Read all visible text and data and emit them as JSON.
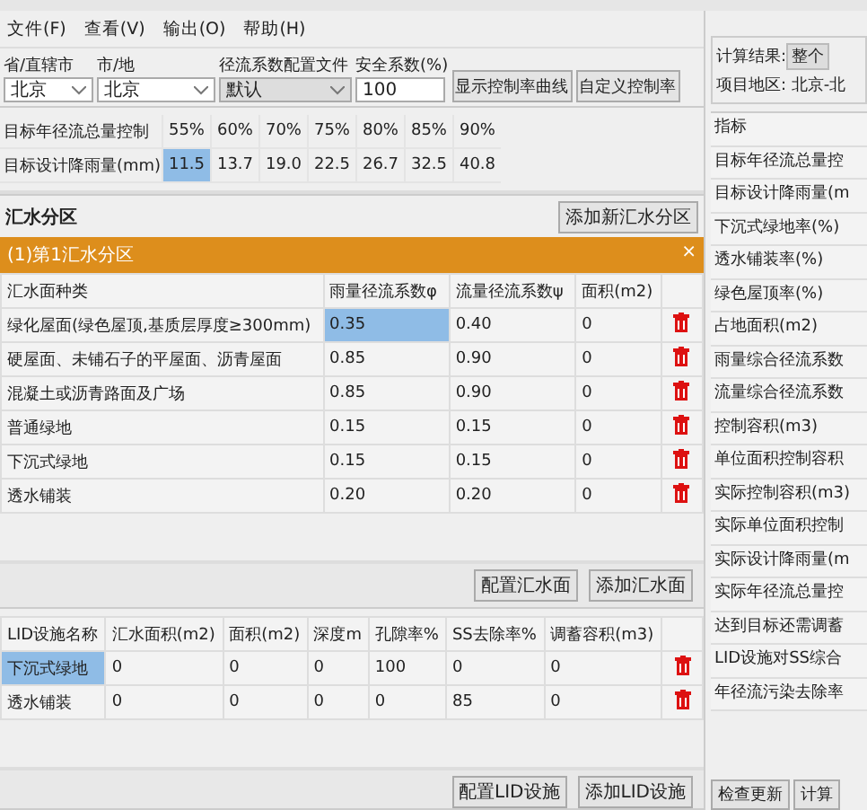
{
  "menu": [
    "文件(F)",
    "查看(V)",
    "输出(O)",
    "帮助(H)"
  ],
  "toolbar": {
    "fields": [
      {
        "label": "省/直辖市",
        "value": "北京",
        "kind": "select"
      },
      {
        "label": "市/地",
        "value": "北京",
        "kind": "select"
      },
      {
        "label": "径流系数配置文件",
        "value": "默认",
        "kind": "select"
      },
      {
        "label": "安全系数(%)",
        "value": "100",
        "kind": "input"
      }
    ],
    "buttons": [
      "显示控制率曲线",
      "自定义控制率"
    ]
  },
  "rates": {
    "row_labels": [
      "目标年径流总量控制",
      "目标设计降雨量(mm)"
    ],
    "columns": [
      {
        "rate": "55%",
        "rainfall": "11.5",
        "selected": true
      },
      {
        "rate": "60%",
        "rainfall": "13.7",
        "selected": false
      },
      {
        "rate": "70%",
        "rainfall": "19.0",
        "selected": false
      },
      {
        "rate": "75%",
        "rainfall": "22.5",
        "selected": false
      },
      {
        "rate": "80%",
        "rainfall": "26.7",
        "selected": false
      },
      {
        "rate": "85%",
        "rainfall": "32.5",
        "selected": false
      },
      {
        "rate": "90%",
        "rainfall": "40.8",
        "selected": false
      }
    ]
  },
  "zones": {
    "title": "汇水分区",
    "add_button": "添加新汇水分区",
    "zone_title": "(1)第1汇水分区",
    "close": "×",
    "columns": [
      "汇水面种类",
      "雨量径流系数φ",
      "流量径流系数ψ",
      "面积(m2)"
    ],
    "rows": [
      {
        "cells": [
          {
            "text": "绿化屋面(绿色屋顶,基质层厚度≥300mm)",
            "selected": false
          },
          {
            "text": "0.35",
            "selected": true
          },
          {
            "text": "0.40",
            "selected": false
          },
          {
            "text": "0",
            "selected": false
          }
        ]
      },
      {
        "cells": [
          {
            "text": "硬屋面、未铺石子的平屋面、沥青屋面",
            "selected": false
          },
          {
            "text": "0.85",
            "selected": false
          },
          {
            "text": "0.90",
            "selected": false
          },
          {
            "text": "0",
            "selected": false
          }
        ]
      },
      {
        "cells": [
          {
            "text": "混凝土或沥青路面及广场",
            "selected": false
          },
          {
            "text": "0.85",
            "selected": false
          },
          {
            "text": "0.90",
            "selected": false
          },
          {
            "text": "0",
            "selected": false
          }
        ]
      },
      {
        "cells": [
          {
            "text": "普通绿地",
            "selected": false
          },
          {
            "text": "0.15",
            "selected": false
          },
          {
            "text": "0.15",
            "selected": false
          },
          {
            "text": "0",
            "selected": false
          }
        ]
      },
      {
        "cells": [
          {
            "text": "下沉式绿地",
            "selected": false
          },
          {
            "text": "0.15",
            "selected": false
          },
          {
            "text": "0.15",
            "selected": false
          },
          {
            "text": "0",
            "selected": false
          }
        ]
      },
      {
        "cells": [
          {
            "text": "透水铺装",
            "selected": false
          },
          {
            "text": "0.20",
            "selected": false
          },
          {
            "text": "0.20",
            "selected": false
          },
          {
            "text": "0",
            "selected": false
          }
        ]
      }
    ],
    "buttons": [
      "配置汇水面",
      "添加汇水面"
    ]
  },
  "lid": {
    "columns": [
      "LID设施名称",
      "汇水面积(m2)",
      "面积(m2)",
      "深度m",
      "孔隙率%",
      "SS去除率%",
      "调蓄容积(m3)"
    ],
    "rows": [
      {
        "cells": [
          {
            "text": "下沉式绿地",
            "selected": true
          },
          {
            "text": "0",
            "selected": false
          },
          {
            "text": "0",
            "selected": false
          },
          {
            "text": "0",
            "selected": false
          },
          {
            "text": "100",
            "selected": false
          },
          {
            "text": "0",
            "selected": false
          },
          {
            "text": "0",
            "selected": false
          }
        ]
      },
      {
        "cells": [
          {
            "text": "透水铺装",
            "selected": false
          },
          {
            "text": "0",
            "selected": false
          },
          {
            "text": "0",
            "selected": false
          },
          {
            "text": "0",
            "selected": false
          },
          {
            "text": "0",
            "selected": false
          },
          {
            "text": "85",
            "selected": false
          },
          {
            "text": "0",
            "selected": false
          }
        ]
      }
    ],
    "buttons": [
      "配置LID设施",
      "添加LID设施"
    ]
  },
  "results": {
    "label": "计算结果:",
    "scope": "整个",
    "region": "项目地区: 北京-北",
    "header": "指标",
    "items": [
      "目标年径流总量控",
      "目标设计降雨量(m",
      "下沉式绿地率(%)",
      "透水铺装率(%)",
      "绿色屋顶率(%)",
      "占地面积(m2)",
      "雨量综合径流系数",
      "流量综合径流系数",
      "控制容积(m3)",
      "单位面积控制容积",
      "实际控制容积(m3)",
      "实际单位面积控制",
      "实际设计降雨量(m",
      "实际年径流总量控",
      "达到目标还需调蓄",
      "LID设施对SS综合",
      "年径流污染去除率"
    ],
    "buttons": [
      "检查更新",
      "计算"
    ]
  }
}
